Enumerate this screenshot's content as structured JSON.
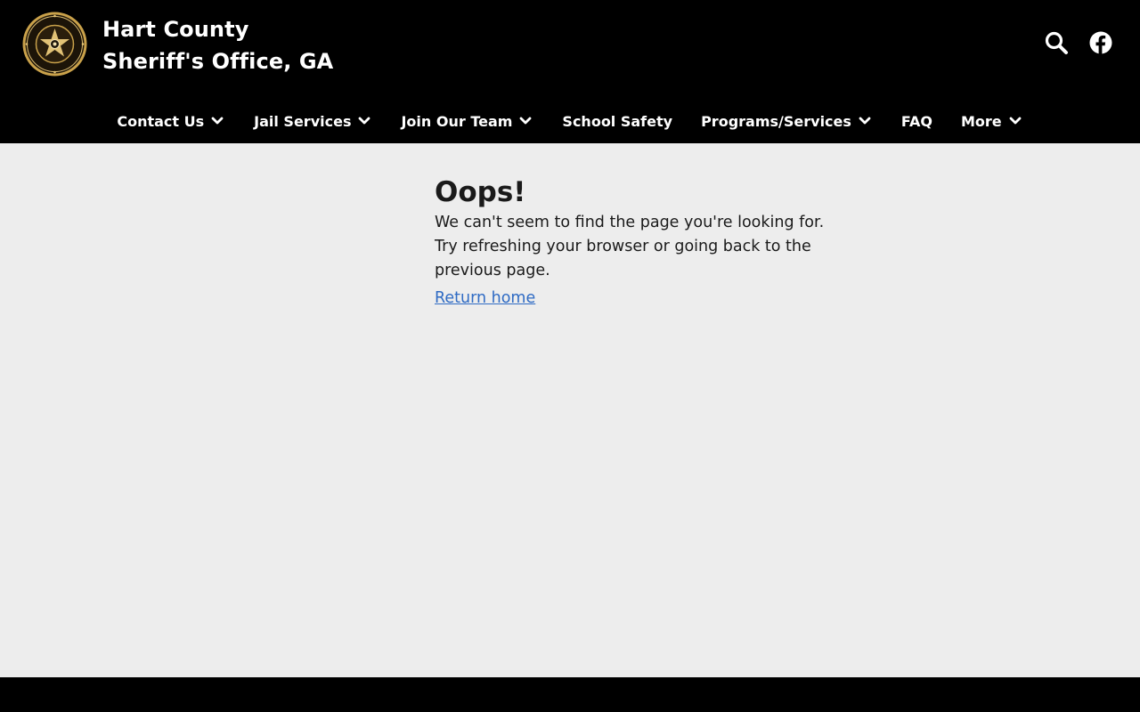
{
  "header": {
    "title_line1": "Hart County",
    "title_line2": "Sheriff's Office, GA",
    "logo_icon": "sheriff-seal-icon",
    "search_icon": "search-icon",
    "facebook_icon": "facebook-icon"
  },
  "nav": {
    "items": [
      {
        "label": "Contact Us",
        "has_dropdown": true
      },
      {
        "label": "Jail Services",
        "has_dropdown": true
      },
      {
        "label": "Join Our Team",
        "has_dropdown": true
      },
      {
        "label": "School Safety",
        "has_dropdown": false
      },
      {
        "label": "Programs/Services",
        "has_dropdown": true
      },
      {
        "label": "FAQ",
        "has_dropdown": false
      },
      {
        "label": "More",
        "has_dropdown": true
      }
    ]
  },
  "main": {
    "heading": "Oops!",
    "message": "We can't seem to find the page you're looking for. Try refreshing your browser or going back to the previous page.",
    "return_link": "Return home"
  },
  "colors": {
    "header_bg": "#000000",
    "content_bg": "#ededed",
    "link": "#2f6bc4",
    "logo_gold": "#c9a14a"
  }
}
